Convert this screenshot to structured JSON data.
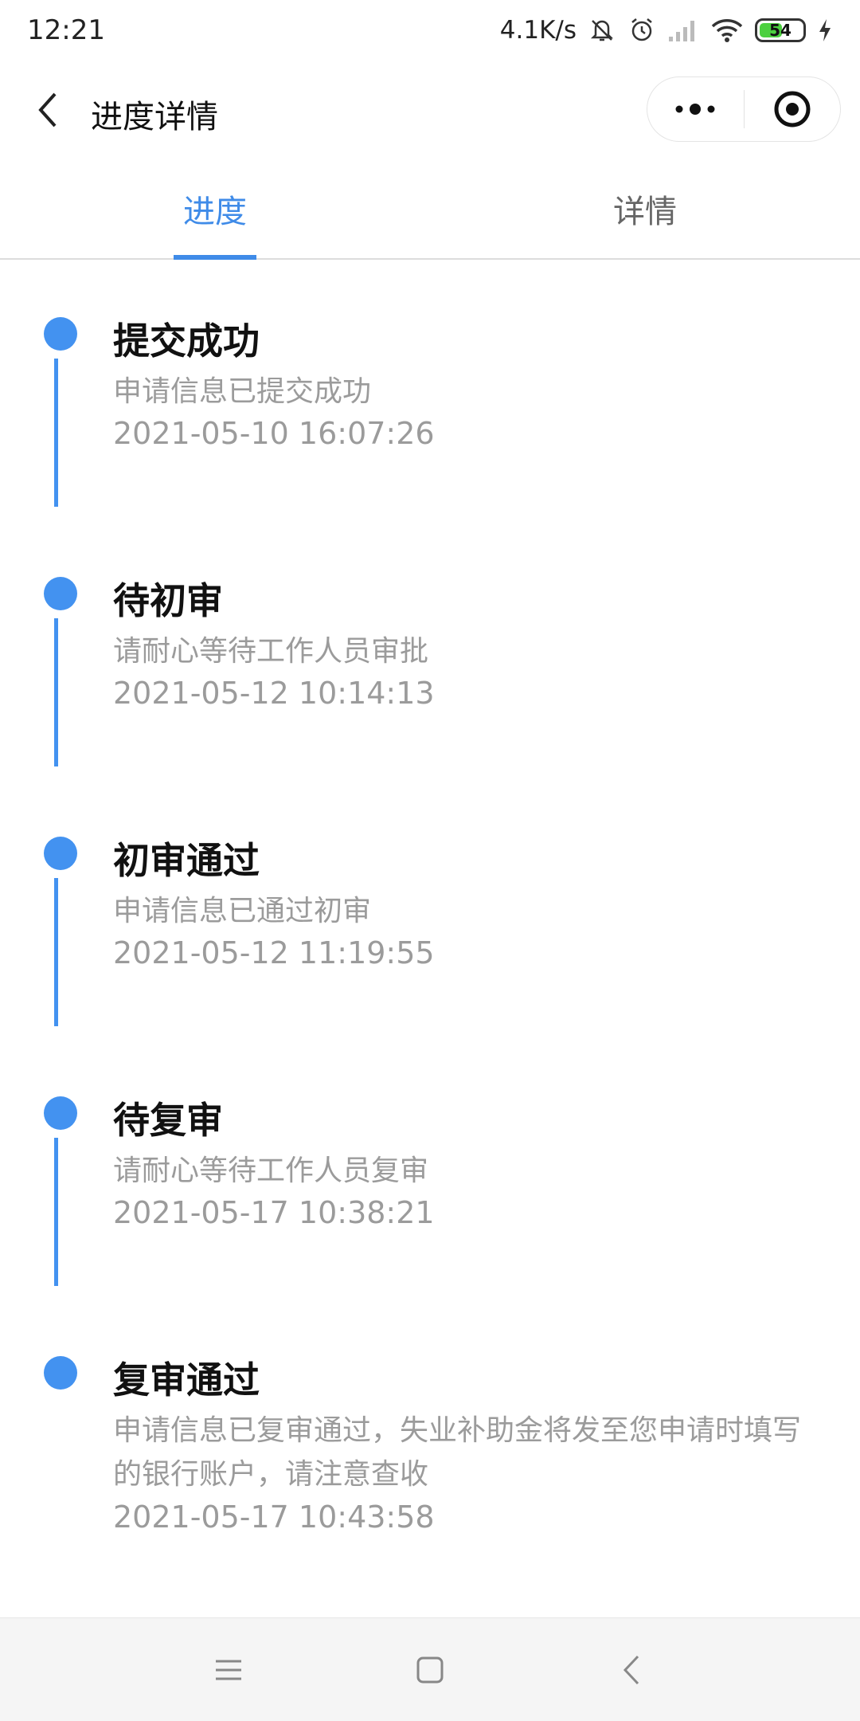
{
  "status_bar": {
    "time": "12:21",
    "network_speed": "4.1K/s",
    "battery_level": "54",
    "battery_fraction": 0.54,
    "icons": [
      "mute-bell-icon",
      "alarm-icon",
      "signal-icon",
      "wifi-icon",
      "battery-icon",
      "charging-icon"
    ]
  },
  "nav": {
    "title": "进度详情",
    "back_icon": "chevron-left-icon",
    "more_icon": "more-dots-icon",
    "close_icon": "target-circle-icon"
  },
  "tabs": [
    {
      "label": "进度",
      "active": true
    },
    {
      "label": "详情",
      "active": false
    }
  ],
  "timeline": [
    {
      "title": "提交成功",
      "desc": "申请信息已提交成功",
      "time": "2021-05-10 16:07:26"
    },
    {
      "title": "待初审",
      "desc": "请耐心等待工作人员审批",
      "time": "2021-05-12 10:14:13"
    },
    {
      "title": "初审通过",
      "desc": "申请信息已通过初审",
      "time": "2021-05-12 11:19:55"
    },
    {
      "title": "待复审",
      "desc": "请耐心等待工作人员复审",
      "time": "2021-05-17 10:38:21"
    },
    {
      "title": "复审通过",
      "desc": "申请信息已复审通过，失业补助金将发至您申请时填写的银行账户，请注意查收",
      "time": "2021-05-17 10:43:58"
    }
  ],
  "colors": {
    "accent": "#3f8be8",
    "timeline": "#4392f0",
    "secondary_text": "#9b9b9b"
  }
}
